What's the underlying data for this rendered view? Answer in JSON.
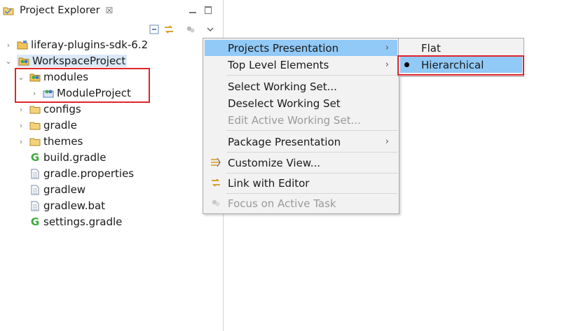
{
  "panel": {
    "title": "Project Explorer",
    "close_glyph": "☒"
  },
  "tree": [
    {
      "label": "liferay-plugins-sdk-6.2",
      "icon": "folder-project-icon",
      "expanded": false
    },
    {
      "label": "WorkspaceProject",
      "icon": "workspace-project-icon",
      "expanded": true,
      "selected": true
    },
    {
      "label": "modules",
      "icon": "modules-folder-icon",
      "expanded": true
    },
    {
      "label": "ModuleProject",
      "icon": "module-project-icon",
      "expanded": false
    },
    {
      "label": "configs",
      "icon": "folder-icon",
      "expanded": false
    },
    {
      "label": "gradle",
      "icon": "folder-icon",
      "expanded": false
    },
    {
      "label": "themes",
      "icon": "folder-icon",
      "expanded": false
    },
    {
      "label": "build.gradle",
      "icon": "gradle-file-icon"
    },
    {
      "label": "gradle.properties",
      "icon": "file-icon"
    },
    {
      "label": "gradlew",
      "icon": "file-icon"
    },
    {
      "label": "gradlew.bat",
      "icon": "file-icon"
    },
    {
      "label": "settings.gradle",
      "icon": "gradle-file-icon"
    }
  ],
  "menu": {
    "items": [
      {
        "label": "Projects Presentation",
        "submenu": true,
        "highlighted": true
      },
      {
        "label": "Top Level Elements",
        "submenu": true
      },
      {
        "label": "Select Working Set..."
      },
      {
        "label": "Deselect Working Set"
      },
      {
        "label": "Edit Active Working Set...",
        "disabled": true
      },
      {
        "label": "Package Presentation",
        "submenu": true
      },
      {
        "label": "Customize View...",
        "icon": "customize-view-icon"
      },
      {
        "label": "Link with Editor",
        "icon": "link-editor-icon"
      },
      {
        "label": "Focus on Active Task",
        "icon": "focus-task-icon",
        "disabled": true
      }
    ],
    "arrow_glyph": "›"
  },
  "submenu": {
    "items": [
      {
        "label": "Flat"
      },
      {
        "label": "Hierarchical",
        "checked": true,
        "highlighted": true
      }
    ]
  },
  "colors": {
    "highlight": "#91c9f7",
    "annotation_red": "#e0252b",
    "selection": "#dbe9f7"
  }
}
